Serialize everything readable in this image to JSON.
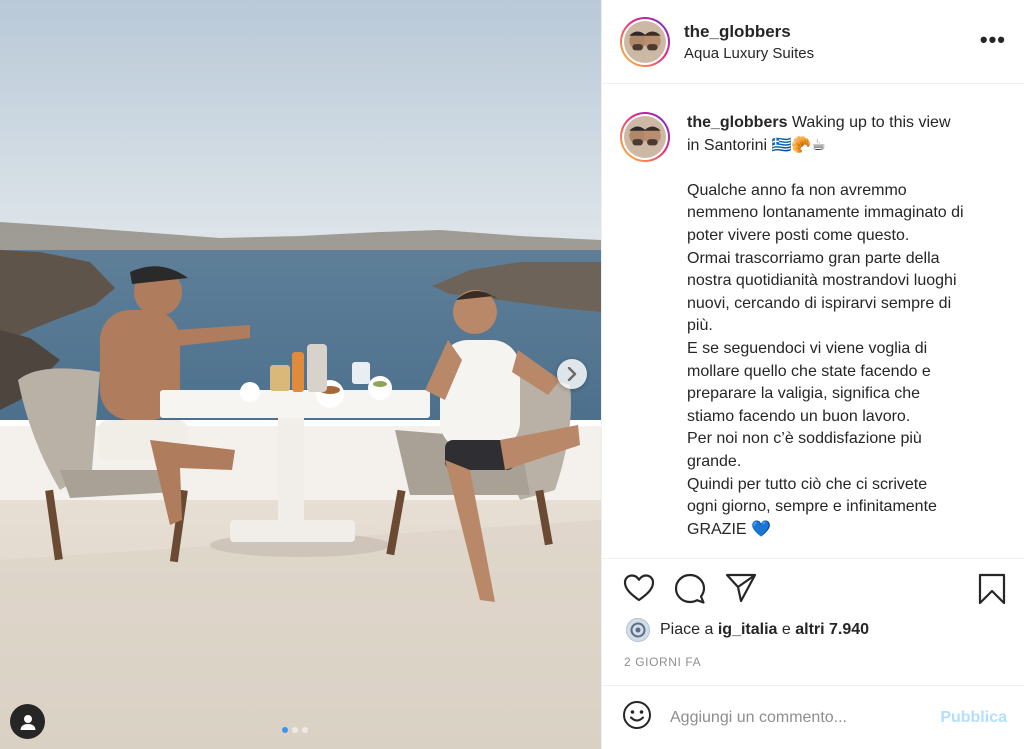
{
  "post": {
    "username": "the_globbers",
    "location": "Aqua Luxury Suites",
    "more_label": "•••"
  },
  "caption": {
    "username": "the_globbers",
    "lines": [
      " Waking up to this view",
      "in Santorini 🇬🇷🥐☕",
      "",
      "Qualche anno fa non avremmo",
      "nemmeno lontanamente immaginato di",
      "poter vivere posti come questo.",
      "Ormai trascorriamo gran parte della",
      "nostra quotidianità mostrandovi luoghi",
      "nuovi, cercando di ispirarvi sempre di",
      "più.",
      "E se seguendoci vi viene voglia di",
      "mollare quello che state facendo e",
      "preparare la valigia, significa che",
      "stiamo facendo un buon lavoro.",
      "Per noi non c’è soddisfazione più",
      "grande.",
      "Quindi per tutto ciò che ci scrivete",
      "ogni giorno, sempre e infinitamente",
      "GRAZIE 💙"
    ]
  },
  "actions": {
    "like_icon": "heart-icon",
    "comment_icon": "comment-icon",
    "share_icon": "paper-plane-icon",
    "save_icon": "bookmark-icon"
  },
  "likes": {
    "prefix": "Piace a ",
    "user": "ig_italia",
    "middle": " e ",
    "others": "altri 7.940"
  },
  "timestamp": "2 GIORNI FA",
  "comment_box": {
    "placeholder": "Aggiungi un commento...",
    "publish_label": "Pubblica",
    "emoji_icon": "smiley-icon"
  },
  "carousel": {
    "slides": 3,
    "active_index": 0
  },
  "colors": {
    "accent_blue": "#3b96ef",
    "publish_disabled": "#b2dffc",
    "muted_text": "#8e8e8e"
  }
}
